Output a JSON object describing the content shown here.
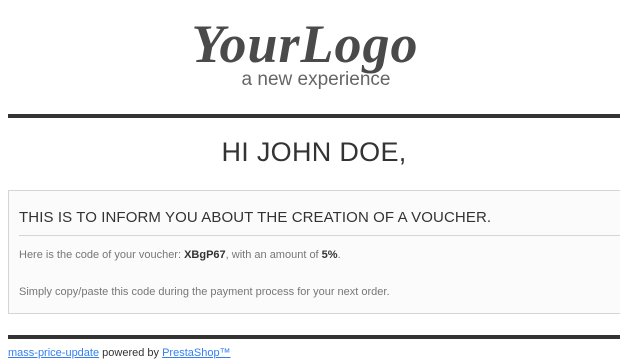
{
  "logo": {
    "brand_text": "YourLogo",
    "tagline": "a new experience"
  },
  "greeting": "HI JOHN DOE,",
  "voucher_box": {
    "title": "THIS IS TO INFORM YOU ABOUT THE CREATION OF A VOUCHER.",
    "code_prefix": "Here is the code of your voucher: ",
    "code": "XBgP67",
    "amount_prefix": ", with an amount of ",
    "amount": "5%",
    "amount_suffix": ".",
    "instructions": "Simply copy/paste this code during the payment process for your next order."
  },
  "footer": {
    "shop_link": "mass-price-update",
    "powered_text": " powered by ",
    "platform_link": "PrestaShop™"
  },
  "colors": {
    "text_dark": "#333333",
    "text_muted": "#777777",
    "link": "#337ff1",
    "box_bg": "#fbfbfb",
    "box_border": "#d6d4d4"
  }
}
